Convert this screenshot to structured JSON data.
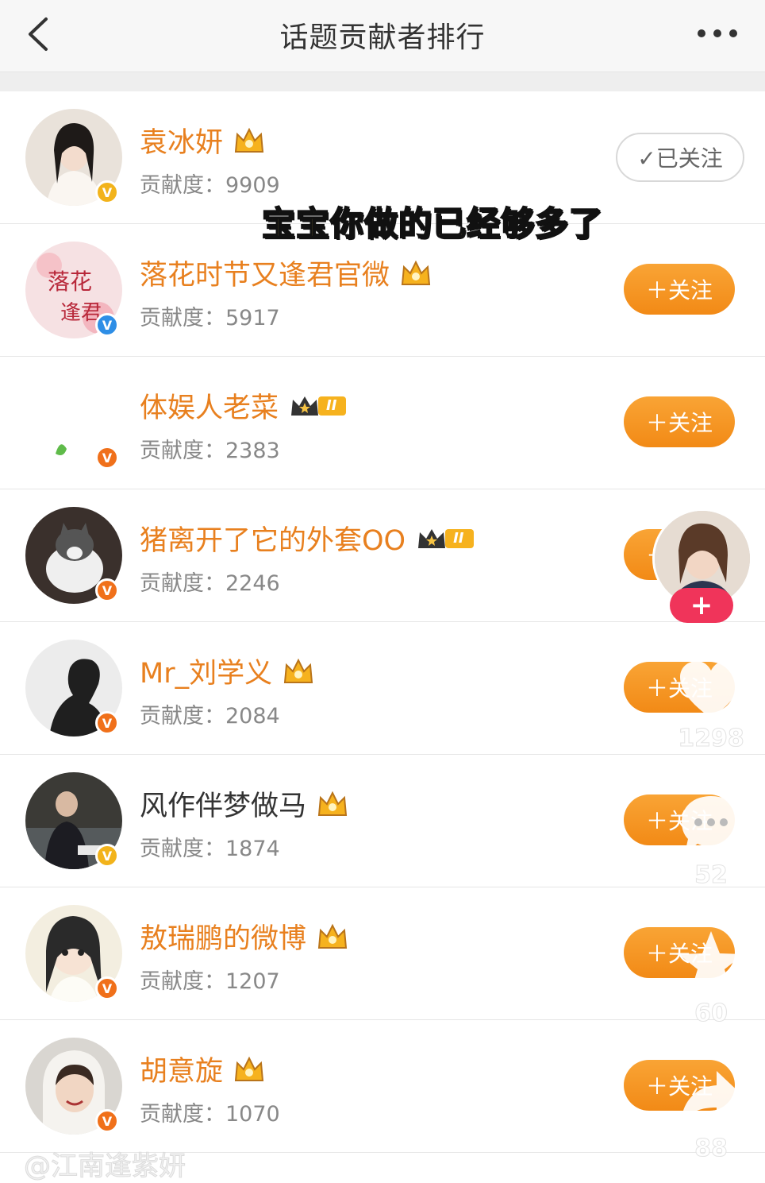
{
  "header": {
    "title": "话题贡献者排行",
    "back_icon": "chevron-left-icon",
    "more_icon": "more-horizontal-icon"
  },
  "caption": "宝宝你做的已经够多了",
  "score_label": "贡献度：",
  "contributors": [
    {
      "name": "袁冰妍",
      "score": "9909",
      "button": "✓已关注",
      "followed": true,
      "badge": "gold",
      "level": ""
    },
    {
      "name": "落花时节又逢君官微",
      "score": "5917",
      "button": "＋关注",
      "followed": false,
      "badge": "blue",
      "level": ""
    },
    {
      "name": "体娱人老菜",
      "score": "2383",
      "button": "＋关注",
      "followed": false,
      "badge": "orange",
      "level": "II"
    },
    {
      "name": "猪离开了它的外套OO",
      "score": "2246",
      "button": "＋关注",
      "followed": false,
      "badge": "orange",
      "level": "II"
    },
    {
      "name": "Mr_刘学义",
      "score": "2084",
      "button": "＋关注",
      "followed": false,
      "badge": "orange",
      "level": ""
    },
    {
      "name": "风作伴梦做马",
      "score": "1874",
      "button": "＋关注",
      "followed": false,
      "badge": "gold",
      "level": ""
    },
    {
      "name": "敖瑞鹏的微博",
      "score": "1207",
      "button": "＋关注",
      "followed": false,
      "badge": "orange",
      "level": ""
    },
    {
      "name": "胡意旋",
      "score": "1070",
      "button": "＋关注",
      "followed": false,
      "badge": "orange",
      "level": ""
    }
  ],
  "overlay": {
    "likes": "1298",
    "comments": "52",
    "favorites": "60",
    "shares": "88",
    "follow_plus": "+"
  },
  "bottom_text": "@江南逢紫妍"
}
